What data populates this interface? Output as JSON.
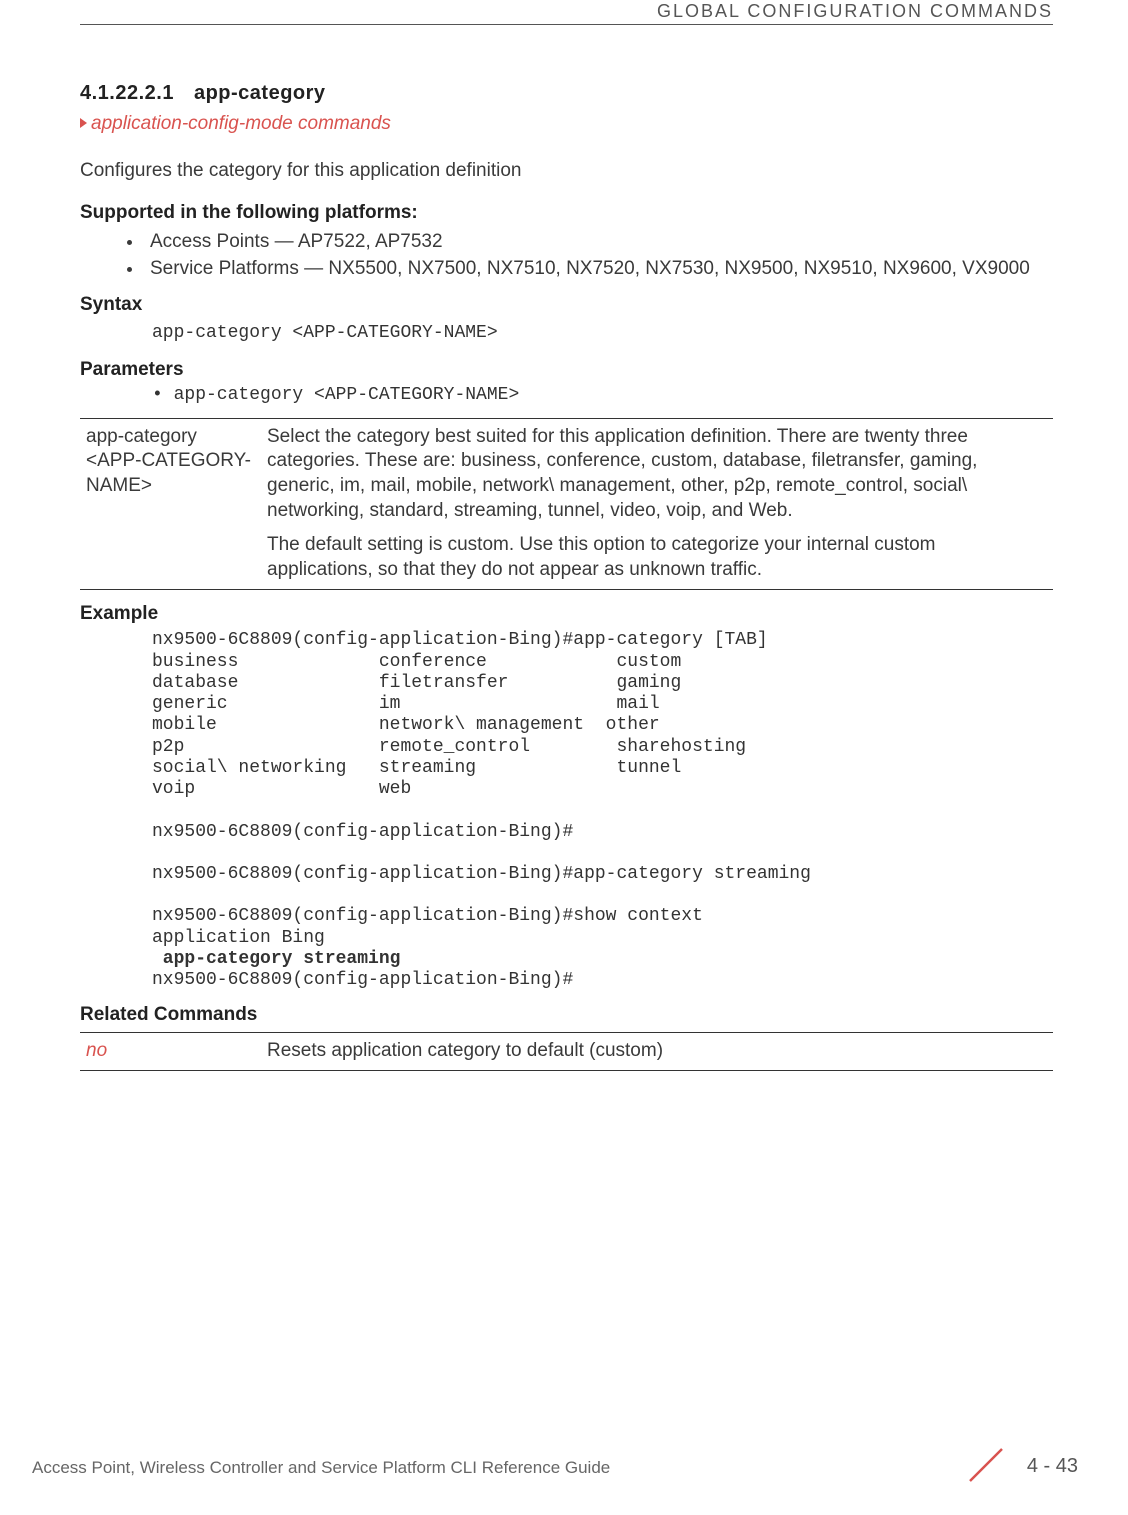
{
  "header": {
    "running_title": "GLOBAL CONFIGURATION COMMANDS"
  },
  "section": {
    "number": "4.1.22.2.1",
    "title": "app-category",
    "breadcrumb": "application-config-mode commands",
    "description": "Configures the category for this application definition"
  },
  "platforms_heading": "Supported in the following platforms:",
  "platforms": [
    "Access Points — AP7522, AP7532",
    "Service Platforms — NX5500, NX7500, NX7510, NX7520, NX7530, NX9500, NX9510, NX9600, VX9000"
  ],
  "syntax_heading": "Syntax",
  "syntax_line": "app-category <APP-CATEGORY-NAME>",
  "parameters_heading": "Parameters",
  "parameters_line": "• app-category <APP-CATEGORY-NAME>",
  "param_table": {
    "left": "app-category <APP-CATEGORY-NAME>",
    "right_p1": "Select the category best suited for this application definition. There are twenty three categories. These are: business, conference, custom, database, filetransfer, gaming, generic, im, mail, mobile, network\\ management, other, p2p, remote_control, social\\ networking, standard, streaming, tunnel, video, voip, and Web.",
    "right_p2": "The default setting is custom. Use this option to categorize your internal custom applications, so that they do not appear as unknown traffic."
  },
  "example_heading": "Example",
  "example": {
    "l01": "nx9500-6C8809(config-application-Bing)#app-category [TAB]",
    "l02": "business             conference            custom",
    "l03": "database             filetransfer          gaming",
    "l04": "generic              im                    mail",
    "l05": "mobile               network\\ management  other",
    "l06": "p2p                  remote_control        sharehosting",
    "l07": "social\\ networking   streaming             tunnel",
    "l08": "voip                 web",
    "l09": "",
    "l10": "nx9500-6C8809(config-application-Bing)#",
    "l11": "",
    "l12": "nx9500-6C8809(config-application-Bing)#app-category streaming",
    "l13": "",
    "l14": "nx9500-6C8809(config-application-Bing)#show context",
    "l15": "application Bing",
    "l16_bold": " app-category streaming",
    "l17": "nx9500-6C8809(config-application-Bing)#"
  },
  "related_heading": "Related Commands",
  "related_table": {
    "left": "no",
    "right": "Resets application category to default (custom)"
  },
  "footer": {
    "guide": "Access Point, Wireless Controller and Service Platform CLI Reference Guide",
    "page": "4 - 43"
  }
}
